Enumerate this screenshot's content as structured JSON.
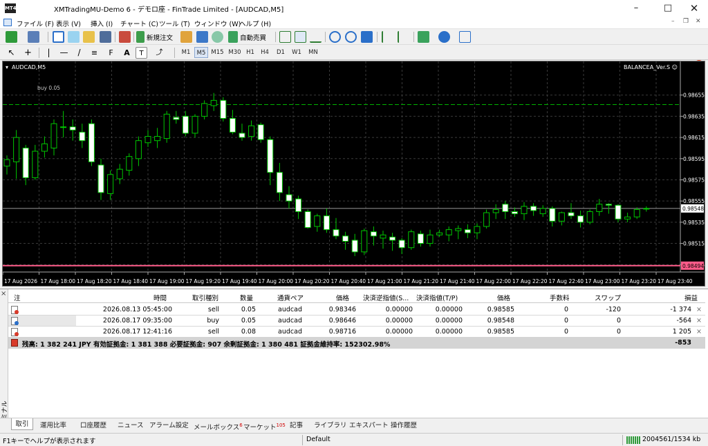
{
  "window": {
    "title": "XMTradingMU-Demo 6 - デモロ座 - FinTrade Limited - [AUDCAD,M5]",
    "app_icon": "MT4",
    "controls": [
      "minimize-icon",
      "maximize-icon",
      "close-icon"
    ]
  },
  "menu": [
    "ファイル (F)",
    "表示 (V)",
    "挿入 (I)",
    "チャート (C)",
    "ツール (T)",
    "ウィンドウ (W)",
    "ヘルプ (H)"
  ],
  "notification_count": "1",
  "toolbar": {
    "new_order": "新規注文",
    "autotrading": "自動売買",
    "timeframes": [
      "M1",
      "M5",
      "M15",
      "M30",
      "H1",
      "H4",
      "D1",
      "W1",
      "MN"
    ],
    "active_timeframe": "M5"
  },
  "chart": {
    "symbol_label": "AUDCAD,M5",
    "ea_label": "BALANCEA_Ver.S ☺",
    "order_label": "buy 0.05",
    "current_price": "0.98548",
    "order_line_price": "0.98494",
    "colors": {
      "background": "#000000",
      "bull": "#00c800",
      "bear": "#ffffff",
      "grid": "#3a3a3a",
      "order_line": "#00b400",
      "stop_line": "#ff5c8a"
    }
  },
  "chart_data": {
    "type": "candlestick",
    "symbol": "AUDCAD",
    "timeframe": "M5",
    "y_ticks": [
      "0.98655",
      "0.98635",
      "0.98615",
      "0.98595",
      "0.98575",
      "0.98555",
      "0.98535",
      "0.98515",
      "0.98495"
    ],
    "ylim": [
      0.98488,
      0.98675
    ],
    "x_ticks": [
      "17 Aug 2026",
      "17 Aug 18:00",
      "17 Aug 18:20",
      "17 Aug 18:40",
      "17 Aug 19:00",
      "17 Aug 19:20",
      "17 Aug 19:40",
      "17 Aug 20:00",
      "17 Aug 20:20",
      "17 Aug 20:40",
      "17 Aug 21:00",
      "17 Aug 21:20",
      "17 Aug 21:40",
      "17 Aug 22:00",
      "17 Aug 22:20",
      "17 Aug 22:40",
      "17 Aug 23:00",
      "17 Aug 23:20",
      "17 Aug 23:40"
    ],
    "grid": true,
    "horizontal_lines": {
      "buy": 0.98646,
      "bid": 0.98548,
      "stop": 0.98494
    },
    "candles": [
      [
        0.98588,
        0.98598,
        0.9858,
        0.98594
      ],
      [
        0.98592,
        0.98622,
        0.98576,
        0.98615
      ],
      [
        0.98605,
        0.98608,
        0.9857,
        0.98577
      ],
      [
        0.98577,
        0.98608,
        0.98575,
        0.98602
      ],
      [
        0.98602,
        0.98616,
        0.98596,
        0.98609
      ],
      [
        0.98605,
        0.98632,
        0.98598,
        0.98628
      ],
      [
        0.98625,
        0.9864,
        0.98615,
        0.98625
      ],
      [
        0.98625,
        0.98632,
        0.98612,
        0.98622
      ],
      [
        0.9862,
        0.98628,
        0.98605,
        0.98612
      ],
      [
        0.98628,
        0.98632,
        0.98588,
        0.98592
      ],
      [
        0.98589,
        0.98595,
        0.98556,
        0.98563
      ],
      [
        0.98562,
        0.98584,
        0.98556,
        0.9858
      ],
      [
        0.98576,
        0.9859,
        0.98571,
        0.98585
      ],
      [
        0.98584,
        0.986,
        0.98579,
        0.98597
      ],
      [
        0.98595,
        0.98616,
        0.98588,
        0.98612
      ],
      [
        0.9861,
        0.98622,
        0.98606,
        0.98616
      ],
      [
        0.98612,
        0.98624,
        0.98605,
        0.98616
      ],
      [
        0.98614,
        0.9864,
        0.9861,
        0.98637
      ],
      [
        0.98634,
        0.9864,
        0.98628,
        0.98632
      ],
      [
        0.98635,
        0.9864,
        0.98616,
        0.98619
      ],
      [
        0.98619,
        0.98637,
        0.98615,
        0.98635
      ],
      [
        0.98635,
        0.9865,
        0.98632,
        0.98647
      ],
      [
        0.98645,
        0.98657,
        0.9864,
        0.9865
      ],
      [
        0.9865,
        0.98653,
        0.9863,
        0.98633
      ],
      [
        0.98633,
        0.98641,
        0.98618,
        0.9862
      ],
      [
        0.98619,
        0.98628,
        0.98612,
        0.98615
      ],
      [
        0.98616,
        0.98631,
        0.98612,
        0.98626
      ],
      [
        0.98627,
        0.98629,
        0.9861,
        0.98613
      ],
      [
        0.98613,
        0.98616,
        0.9857,
        0.98582
      ],
      [
        0.98582,
        0.98591,
        0.98555,
        0.98563
      ],
      [
        0.98561,
        0.98569,
        0.98548,
        0.98555
      ],
      [
        0.98557,
        0.9856,
        0.98538,
        0.98545
      ],
      [
        0.98545,
        0.98547,
        0.98529,
        0.9853
      ],
      [
        0.98531,
        0.98543,
        0.98526,
        0.98541
      ],
      [
        0.98541,
        0.98548,
        0.98525,
        0.98528
      ],
      [
        0.98528,
        0.98539,
        0.98519,
        0.98522
      ],
      [
        0.98522,
        0.98526,
        0.98509,
        0.98517
      ],
      [
        0.98518,
        0.98524,
        0.98503,
        0.98507
      ],
      [
        0.98507,
        0.98529,
        0.98504,
        0.98527
      ],
      [
        0.98526,
        0.98531,
        0.98513,
        0.98522
      ],
      [
        0.9852,
        0.98527,
        0.9851,
        0.98523
      ],
      [
        0.98521,
        0.98525,
        0.98508,
        0.98518
      ],
      [
        0.98518,
        0.9852,
        0.98505,
        0.98511
      ],
      [
        0.98511,
        0.98528,
        0.98509,
        0.98526
      ],
      [
        0.98524,
        0.98527,
        0.98512,
        0.98515
      ],
      [
        0.98515,
        0.98528,
        0.98512,
        0.98523
      ],
      [
        0.98523,
        0.98528,
        0.98521,
        0.98525
      ],
      [
        0.98523,
        0.98531,
        0.98517,
        0.98528
      ],
      [
        0.98527,
        0.98532,
        0.98519,
        0.98529
      ],
      [
        0.98528,
        0.98533,
        0.9852,
        0.98525
      ],
      [
        0.98525,
        0.98534,
        0.98519,
        0.98531
      ],
      [
        0.98531,
        0.98547,
        0.98529,
        0.98544
      ],
      [
        0.98544,
        0.98552,
        0.98538,
        0.98547
      ],
      [
        0.98552,
        0.98555,
        0.98538,
        0.98545
      ],
      [
        0.98545,
        0.98549,
        0.9854,
        0.98543
      ],
      [
        0.98543,
        0.98554,
        0.98537,
        0.9855
      ],
      [
        0.9855,
        0.98553,
        0.98541,
        0.98546
      ],
      [
        0.98543,
        0.98551,
        0.9854,
        0.98548
      ],
      [
        0.98548,
        0.9855,
        0.98531,
        0.98536
      ],
      [
        0.98536,
        0.98545,
        0.98532,
        0.98544
      ],
      [
        0.98544,
        0.98553,
        0.98538,
        0.98541
      ],
      [
        0.98541,
        0.98546,
        0.9853,
        0.98535
      ],
      [
        0.98535,
        0.98547,
        0.98533,
        0.98545
      ],
      [
        0.98545,
        0.98557,
        0.98541,
        0.98552
      ],
      [
        0.98552,
        0.98553,
        0.98543,
        0.98551
      ],
      [
        0.98551,
        0.98552,
        0.98535,
        0.98538
      ],
      [
        0.98538,
        0.98544,
        0.98535,
        0.9854
      ],
      [
        0.9854,
        0.98549,
        0.98538,
        0.98547
      ],
      [
        0.98548,
        0.9855,
        0.98545,
        0.98548
      ]
    ]
  },
  "terminal": {
    "headers": {
      "order": "注",
      "time": "時間",
      "type": "取引種別",
      "volume": "数量",
      "symbol": "通貨ペア",
      "price": "価格",
      "sl": "決済逆指値(S...",
      "tp": "決済指値(T/P)",
      "cur_price": "価格",
      "commission": "手数料",
      "swap": "スワップ",
      "profit": "損益"
    },
    "rows": [
      {
        "time": "2026.08.13 05:45:00",
        "type": "sell",
        "volume": "0.05",
        "symbol": "audcad",
        "price": "0.98346",
        "sl": "0.00000",
        "tp": "0.00000",
        "cur_price": "0.98585",
        "commission": "0",
        "swap": "-120",
        "profit": "-1 374"
      },
      {
        "time": "2026.08.17 09:35:00",
        "type": "buy",
        "volume": "0.05",
        "symbol": "audcad",
        "price": "0.98646",
        "sl": "0.00000",
        "tp": "0.00000",
        "cur_price": "0.98548",
        "commission": "0",
        "swap": "0",
        "profit": "-564"
      },
      {
        "time": "2026.08.17 12:41:16",
        "type": "sell",
        "volume": "0.08",
        "symbol": "audcad",
        "price": "0.98716",
        "sl": "0.00000",
        "tp": "0.00000",
        "cur_price": "0.98585",
        "commission": "0",
        "swap": "0",
        "profit": "1 205"
      }
    ],
    "balance_line": "残高: 1 382 241 JPY  有効証拠金: 1 381 388  必要証拠金: 907  余剰証拠金: 1 380 481  証拠金維持率: 152302.98%",
    "total_profit": "-853",
    "side_label": "ターミナル",
    "close_symbol": "×",
    "tabs": [
      {
        "label": "取引",
        "badge": ""
      },
      {
        "label": "運用比率",
        "badge": ""
      },
      {
        "label": "口座履歴",
        "badge": ""
      },
      {
        "label": "ニュース",
        "badge": ""
      },
      {
        "label": "アラーム設定",
        "badge": ""
      },
      {
        "label": "メールボックス",
        "badge": "6"
      },
      {
        "label": "マーケット",
        "badge": "105"
      },
      {
        "label": "記事",
        "badge": ""
      },
      {
        "label": "ライブラリ",
        "badge": ""
      },
      {
        "label": "エキスパート",
        "badge": ""
      },
      {
        "label": "操作履歴",
        "badge": ""
      }
    ]
  },
  "status": {
    "help": "F1キーでヘルプが表示されます",
    "profile": "Default",
    "traffic": "2004561/1534 kb"
  }
}
